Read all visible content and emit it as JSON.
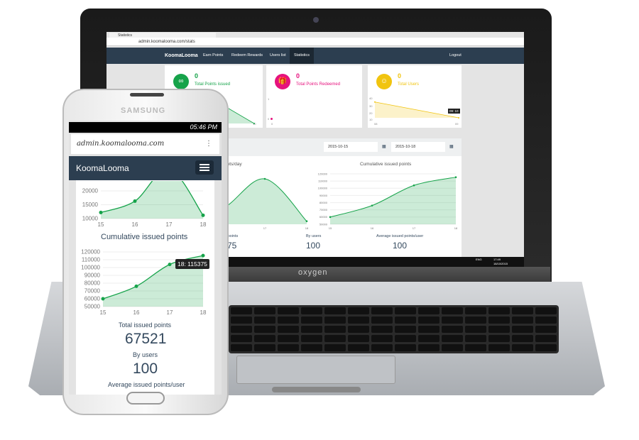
{
  "laptop": {
    "brand": "oxygen",
    "browser": {
      "tab_title": "Statistics",
      "url": "admin.koomalooma.com/stats"
    },
    "nav": {
      "brand": "KoomaLooma",
      "items": [
        "Earn Points",
        "Redeem Rewards",
        "Users list",
        "Statistics"
      ],
      "active": "Statistics",
      "logout": "Logout"
    },
    "cards": [
      {
        "value": "0",
        "label": "Total Points issued",
        "color": "#16a34a",
        "icon": "link-icon",
        "ticks": {
          "x": [
            "10"
          ]
        }
      },
      {
        "value": "0",
        "label": "Total Points Redeemed",
        "color": "#e6127e",
        "icon": "gift-icon",
        "ticks": {
          "y": [
            "1",
            "0"
          ],
          "x": [
            "0"
          ]
        }
      },
      {
        "value": "0",
        "label": "Total Users",
        "color": "#f1c40f",
        "icon": "user-icon",
        "ticks": {
          "y": [
            "40",
            "30",
            "20",
            "10"
          ],
          "x": [
            "08",
            "09"
          ]
        },
        "tooltip": "09: 10"
      }
    ],
    "filters": {
      "start_date": "2015-10-15",
      "end_date": "2015-10-18"
    },
    "stats": {
      "total_label": "Total issued points",
      "total_value": "75",
      "users_label": "By users",
      "users_value": "100",
      "avg_label": "Average issued points/user",
      "avg_value": "100"
    },
    "chart_titles": {
      "per_day": "Issued points/day",
      "cumulative": "Cumulative issued points"
    },
    "taskbar": {
      "lang": "ENG",
      "time": "17:49",
      "date": "18/10/2015"
    }
  },
  "phone": {
    "brand": "SAMSUNG",
    "status_time": "05:46 PM",
    "url": "admin.koomalooma.com",
    "nav_brand": "KoomaLooma",
    "chart2_title": "Cumulative issued points",
    "tooltip": "18: 115375",
    "stats": {
      "total_label": "Total issued points",
      "total_value": "67521",
      "users_label": "By users",
      "users_value": "100",
      "avg_label": "Average issued points/user"
    }
  },
  "chart_data": [
    {
      "type": "area",
      "title": "Issued points/day",
      "x": [
        "15",
        "16",
        "17",
        "18"
      ],
      "y": [
        12200,
        16300,
        28000,
        11200
      ],
      "yticks": [
        10000,
        15000,
        20000
      ],
      "color": "#16a34a"
    },
    {
      "type": "area",
      "title": "Cumulative issued points",
      "x": [
        "15",
        "16",
        "17",
        "18"
      ],
      "y": [
        60000,
        76000,
        104000,
        115375
      ],
      "ylim": [
        50000,
        120000
      ],
      "yticks": [
        50000,
        60000,
        70000,
        80000,
        90000,
        100000,
        110000,
        120000
      ],
      "color": "#16a34a"
    },
    {
      "type": "area",
      "title": "Total Users",
      "x": [
        "08",
        "09"
      ],
      "y": [
        33,
        10
      ],
      "ylim": [
        10,
        40
      ],
      "color": "#f1c40f"
    }
  ]
}
